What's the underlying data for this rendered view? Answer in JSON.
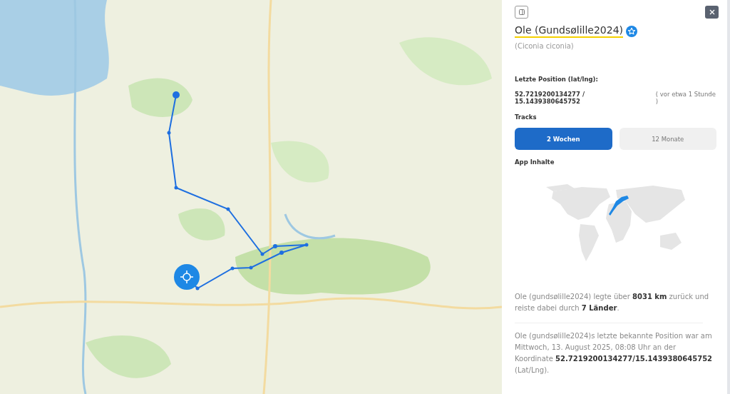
{
  "panel": {
    "title": "Ole (Gundsølille2024)",
    "subtitle": "(Ciconia ciconia)",
    "last_position_label": "Letzte Position (lat/lng):",
    "coordinates": "52.7219200134277 / 15.1439380645752",
    "time_ago": "( vor etwa 1 Stunde )",
    "tracks_label": "Tracks",
    "track_tabs": [
      {
        "label": "2 Wochen",
        "selected": true
      },
      {
        "label": "12 Monate",
        "selected": false
      }
    ],
    "app_content_label": "App Inhalte",
    "summary": "Ole (gundsølille2024) legte über **8031 km** zurück und reiste dabei durch **7 Länder**.",
    "last_known": "Ole (gundsølille2024)s letzte bekannte Position war am Mittwoch, 13. August 2025, 08:08 Uhr an der Koordinate **52.7219200134277/15.1439380645752** (Lat/Lng)."
  }
}
